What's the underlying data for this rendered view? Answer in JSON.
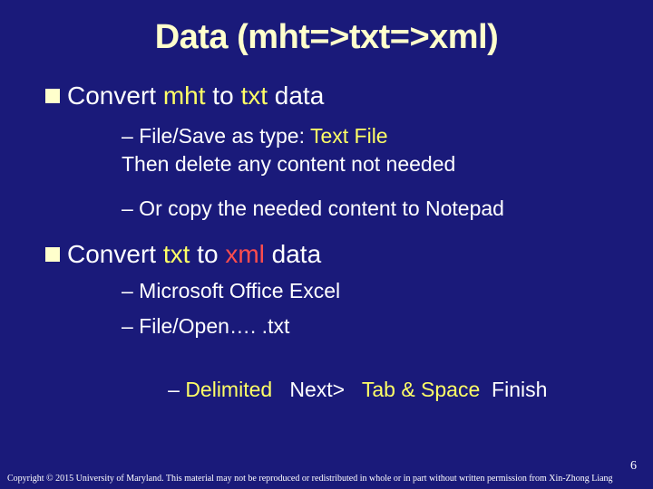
{
  "title": "Data (mht=>txt=>xml)",
  "sec1": {
    "lead": "Convert ",
    "hl1": "mht",
    "mid1": " to ",
    "hl2": "txt",
    "tail": " data",
    "sub1_pre": "– File/Save as type: ",
    "sub1_hl": "Text File",
    "sub1_line2": "Then delete any content not needed",
    "sub2": "– Or copy the needed content to Notepad"
  },
  "sec2": {
    "lead": "Convert ",
    "hl1": "txt",
    "mid1": " to ",
    "hl2": "xml",
    "tail": " data",
    "sub1": "– Microsoft Office Excel",
    "sub2": "– File/Open…. .txt",
    "sub3_a": "– ",
    "sub3_b": "Delimited",
    "sub3_c": "   Next>   ",
    "sub3_d": "Tab & Space",
    "sub3_e": "  Finish"
  },
  "pagenum": "6",
  "copyright": "Copyright © 2015 University of Maryland. This material may not be reproduced or redistributed in whole or in part without written permission from Xin-Zhong Liang"
}
